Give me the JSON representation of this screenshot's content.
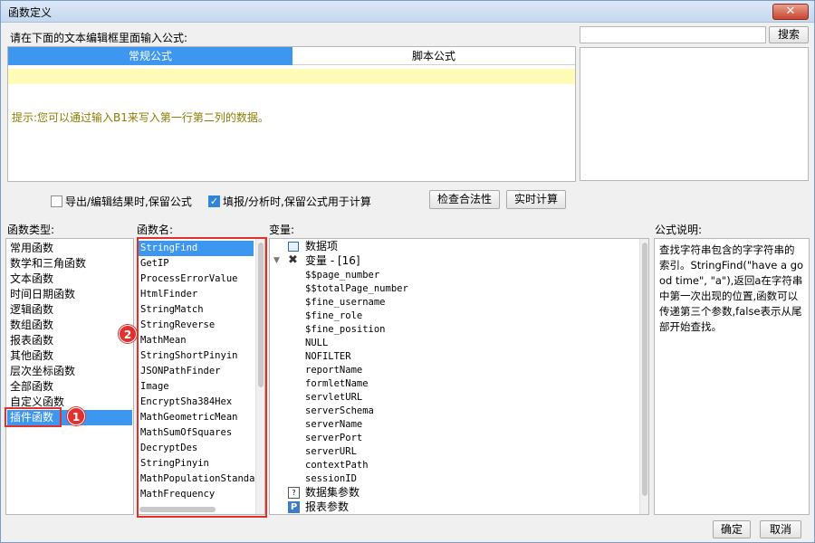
{
  "window": {
    "title": "函数定义",
    "close": "✕"
  },
  "editor": {
    "prompt": "请在下面的文本编辑框里面输入公式:",
    "tabs": [
      "常规公式",
      "脚本公式"
    ],
    "hint": "提示:您可以通过输入B1来写入第一行第二列的数据。"
  },
  "search": {
    "value": "",
    "button": "搜索"
  },
  "options": {
    "export_label": "导出/编辑结果时,保留公式",
    "export_checked": false,
    "fill_label": "填报/分析时,保留公式用于计算",
    "fill_checked": true,
    "check_button": "检查合法性",
    "realtime_button": "实时计算"
  },
  "categories": {
    "label": "函数类型:",
    "items": [
      "常用函数",
      "数学和三角函数",
      "文本函数",
      "时间日期函数",
      "逻辑函数",
      "数组函数",
      "报表函数",
      "其他函数",
      "层次坐标函数",
      "全部函数",
      "自定义函数",
      "插件函数"
    ],
    "selected": "插件函数"
  },
  "functions": {
    "label": "函数名:",
    "items": [
      "StringFind",
      "GetIP",
      "ProcessErrorValue",
      "HtmlFinder",
      "StringMatch",
      "StringReverse",
      "MathMean",
      "StringShortPinyin",
      "JSONPathFinder",
      "Image",
      "EncryptSha384Hex",
      "MathGeometricMean",
      "MathSumOfSquares",
      "DecryptDes",
      "StringPinyin",
      "MathPopulationStandar",
      "MathFrequency"
    ],
    "selected": "StringFind"
  },
  "variables": {
    "label": "变量:",
    "data_item": "数据项",
    "var_group": "变量 - [16]",
    "items": [
      "$$page_number",
      "$$totalPage_number",
      "$fine_username",
      "$fine_role",
      "$fine_position",
      "NULL",
      "NOFILTER",
      "reportName",
      "formletName",
      "servletURL",
      "serverSchema",
      "serverName",
      "serverPort",
      "serverURL",
      "contextPath",
      "sessionID"
    ],
    "dataset_params": "数据集参数",
    "report_params": "报表参数"
  },
  "description": {
    "label": "公式说明:",
    "text": "查找字符串包含的字字符串的索引。StringFind(\"have a good time\", \"a\"),返回a在字符串中第一次出现的位置,函数可以传递第三个参数,false表示从尾部开始查找。"
  },
  "badges": [
    "1",
    "2"
  ],
  "footer": {
    "ok": "确定",
    "cancel": "取消"
  },
  "colors": {
    "accent": "#3d97f1",
    "hint": "#8b7d00",
    "highlight_bar": "#fffcb8",
    "annotation": "#e0312e"
  }
}
